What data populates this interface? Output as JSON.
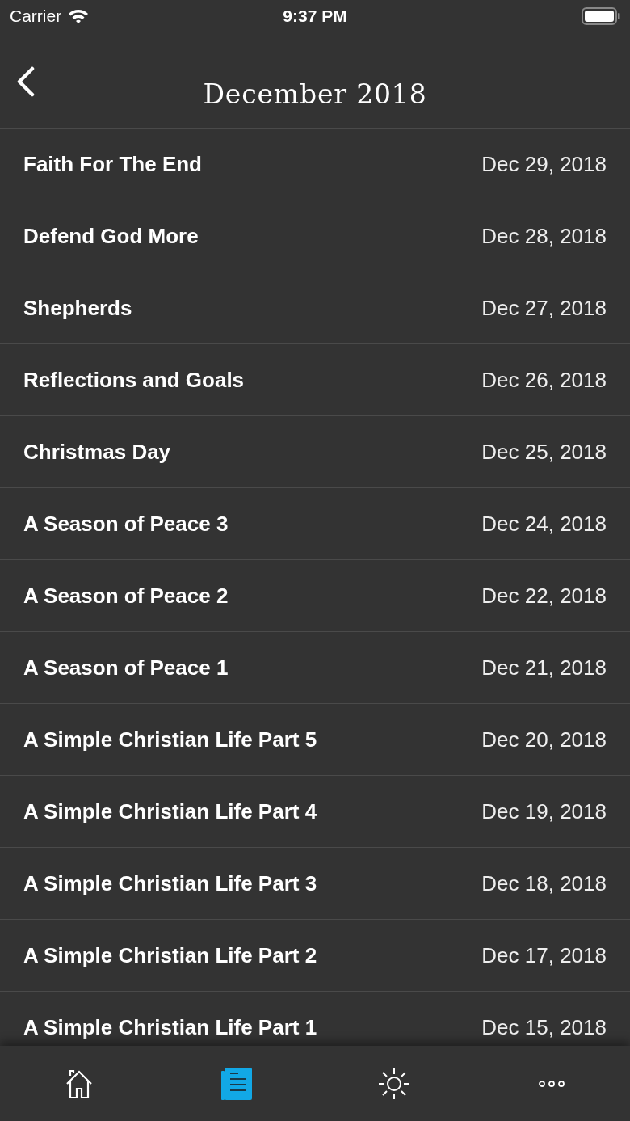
{
  "status_bar": {
    "carrier": "Carrier",
    "time": "9:37 PM"
  },
  "nav": {
    "title": "December 2018"
  },
  "entries": [
    {
      "title": "Faith For The End",
      "date": "Dec 29, 2018"
    },
    {
      "title": "Defend God More",
      "date": "Dec 28, 2018"
    },
    {
      "title": "Shepherds",
      "date": "Dec 27, 2018"
    },
    {
      "title": "Reflections and Goals",
      "date": "Dec 26, 2018"
    },
    {
      "title": "Christmas Day",
      "date": "Dec 25, 2018"
    },
    {
      "title": "A Season of Peace 3",
      "date": "Dec 24, 2018"
    },
    {
      "title": "A Season of Peace 2",
      "date": "Dec 22, 2018"
    },
    {
      "title": "A Season of Peace 1",
      "date": "Dec 21, 2018"
    },
    {
      "title": "A Simple Christian Life Part 5",
      "date": "Dec 20, 2018"
    },
    {
      "title": "A Simple Christian Life Part 4",
      "date": "Dec 19, 2018"
    },
    {
      "title": "A Simple Christian Life Part 3",
      "date": "Dec 18, 2018"
    },
    {
      "title": "A Simple Christian Life Part 2",
      "date": "Dec 17, 2018"
    },
    {
      "title": "A Simple Christian Life Part 1",
      "date": "Dec 15, 2018"
    }
  ],
  "tab_bar": [
    {
      "kind": "home",
      "selected": false
    },
    {
      "kind": "articles",
      "selected": true
    },
    {
      "kind": "brightness",
      "selected": false
    },
    {
      "kind": "more",
      "selected": false
    }
  ]
}
